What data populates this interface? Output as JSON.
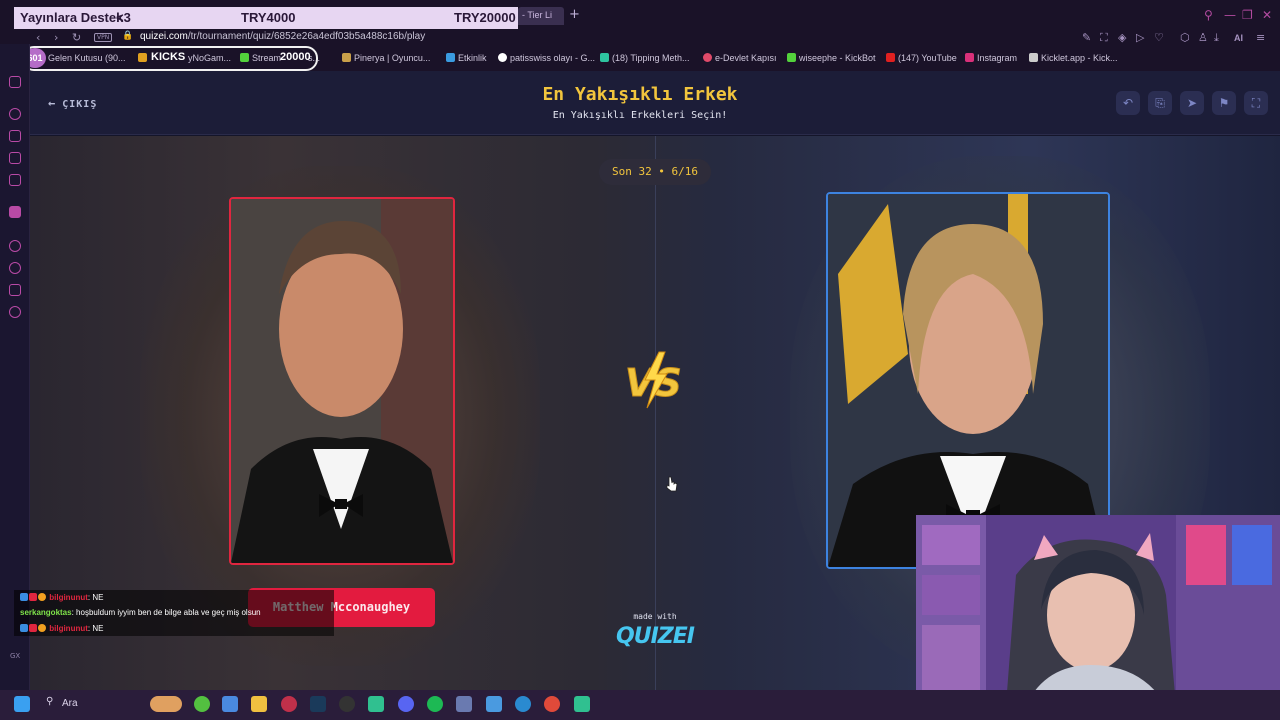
{
  "overlay": {
    "donation_label": "Yayınlara Destek",
    "donation_heart": "<3",
    "donation_mid": "TRY4000",
    "donation_goal": "TRY20000"
  },
  "browser": {
    "active_tab_title": "- Tier Li",
    "url_host": "quizei.com",
    "url_path": "/tr/tournament/quiz/6852e26a4edf03b5a488c16b/play",
    "vpn_label": "VPN",
    "ai_label": "AI"
  },
  "bookmarks": [
    {
      "label": "Gelen Kutusu (90...",
      "icon_color": "#2b6be0"
    },
    {
      "label": "yNoGam...",
      "icon_color": "#e0a020"
    },
    {
      "label": "Stream",
      "icon_color": "#53d13c"
    },
    {
      "label": "s...",
      "icon_color": "#9b59b6"
    },
    {
      "label": "Pinerya | Oyuncu...",
      "icon_color": "#c9a04a"
    },
    {
      "label": "Etkinlik",
      "icon_color": "#3a9be0"
    },
    {
      "label": "patisswiss olayı - G...",
      "icon_color": "#ffffff"
    },
    {
      "label": "(18) Tipping Meth...",
      "icon_color": "#2ec4a0"
    },
    {
      "label": "e-Devlet Kapısı",
      "icon_color": "#e04a6a"
    },
    {
      "label": "wiseephe - KickBot",
      "icon_color": "#53d13c"
    },
    {
      "label": "(147) YouTube",
      "icon_color": "#e02020"
    },
    {
      "label": "Instagram",
      "icon_color": "#d9307a"
    },
    {
      "label": "Kicklet.app - Kick...",
      "icon_color": "#cccccc"
    }
  ],
  "bookmark_overlay": {
    "count_badge": "601",
    "kicks_label": "KICKS",
    "stream_value": "20000"
  },
  "page": {
    "exit_label": "ÇIKIŞ",
    "title": "En Yakışıklı Erkek",
    "subtitle": "En Yakışıklı Erkekleri Seçin!",
    "round_label": "Son 32 • 6/16",
    "vs_label": "VS",
    "left_name": "Matthew Mcconaughey",
    "made_with": "made with",
    "brand": "QUIZEI",
    "header_buttons": [
      "undo-icon",
      "share-icon",
      "send-icon",
      "flag-icon",
      "fullscreen-icon"
    ]
  },
  "colors": {
    "accent_yellow": "#f2c53d",
    "left_border": "#e0263f",
    "right_border": "#3d83e0",
    "name_bg": "#e31b3f",
    "brand_blue": "#46c6f0"
  },
  "chat": [
    {
      "user": "bilginunut",
      "message": ": NE"
    },
    {
      "user": "serkangoktas",
      "message": ": hoşbuldum iyyim ben de bilge abla ve geç miş olsun"
    },
    {
      "user": "bilginunut",
      "message": ": NE"
    }
  ],
  "taskbar": {
    "search_label": "Ara"
  },
  "sidebar_footer": "GX"
}
